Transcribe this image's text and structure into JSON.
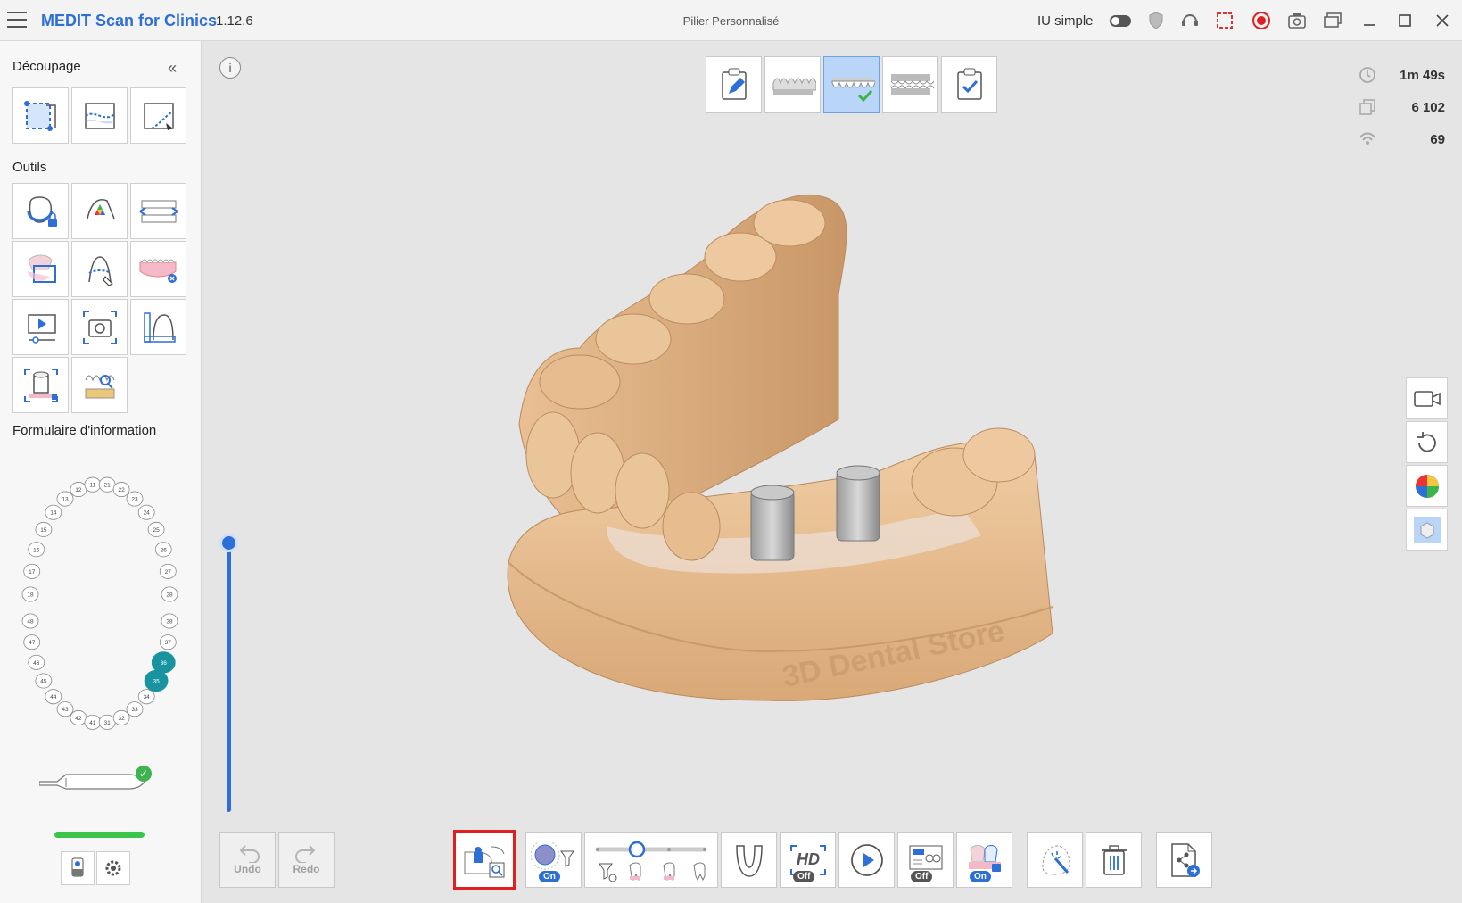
{
  "titlebar": {
    "brand": "MEDIT Scan for Clinics",
    "version": "1.12.6",
    "window_title": "Pilier Personnalisé",
    "simple_ui_label": "IU simple"
  },
  "left_panel": {
    "section_cutting": "Découpage",
    "section_tools": "Outils",
    "section_info_form": "Formulaire d'information",
    "tooth_numbers_upper": [
      "18",
      "17",
      "16",
      "15",
      "14",
      "13",
      "12",
      "11",
      "21",
      "22",
      "23",
      "24",
      "25",
      "26",
      "27",
      "28"
    ],
    "tooth_numbers_lower": [
      "48",
      "47",
      "46",
      "45",
      "44",
      "43",
      "42",
      "41",
      "31",
      "32",
      "33",
      "34",
      "35",
      "36",
      "37",
      "38"
    ],
    "selected_teeth": [
      "35",
      "36"
    ],
    "accent_color": "#1a93a1"
  },
  "stats": {
    "time": "1m 49s",
    "frames": "6 102",
    "count": "69"
  },
  "stages": {
    "active_index": 2
  },
  "bottom_toolbar": {
    "undo_label": "Undo",
    "redo_label": "Redo",
    "filter_toggle": "On",
    "hd_label": "HD",
    "hd_toggle": "Off",
    "ai_toggle": "Off",
    "lock_toggle": "On"
  },
  "model": {
    "engraving": "3D Dental Store"
  },
  "colors": {
    "brand_blue": "#2d6fd6",
    "model_tan": "#e7bd90",
    "highlight_red": "#e02020",
    "status_green": "#3bc44b"
  }
}
